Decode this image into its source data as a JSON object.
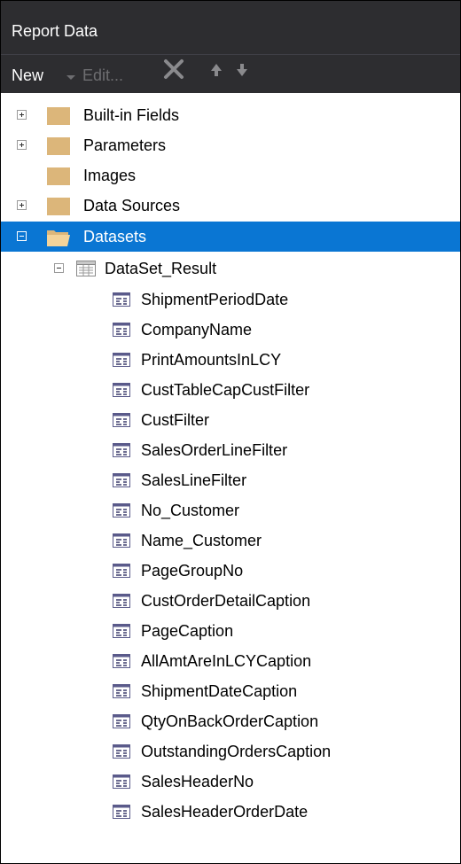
{
  "panel": {
    "title": "Report Data"
  },
  "toolbar": {
    "new_label": "New",
    "edit_label": "Edit..."
  },
  "tree": {
    "builtin_fields": "Built-in Fields",
    "parameters": "Parameters",
    "images": "Images",
    "data_sources": "Data Sources",
    "datasets": "Datasets",
    "dataset_result": "DataSet_Result",
    "fields": [
      "ShipmentPeriodDate",
      "CompanyName",
      "PrintAmountsInLCY",
      "CustTableCapCustFilter",
      "CustFilter",
      "SalesOrderLineFilter",
      "SalesLineFilter",
      "No_Customer",
      "Name_Customer",
      "PageGroupNo",
      "CustOrderDetailCaption",
      "PageCaption",
      "AllAmtAreInLCYCaption",
      "ShipmentDateCaption",
      "QtyOnBackOrderCaption",
      "OutstandingOrdersCaption",
      "SalesHeaderNo",
      "SalesHeaderOrderDate"
    ]
  },
  "colors": {
    "selection": "#0a76d3",
    "chrome": "#2d2d30",
    "folder": "#dcb67a"
  }
}
